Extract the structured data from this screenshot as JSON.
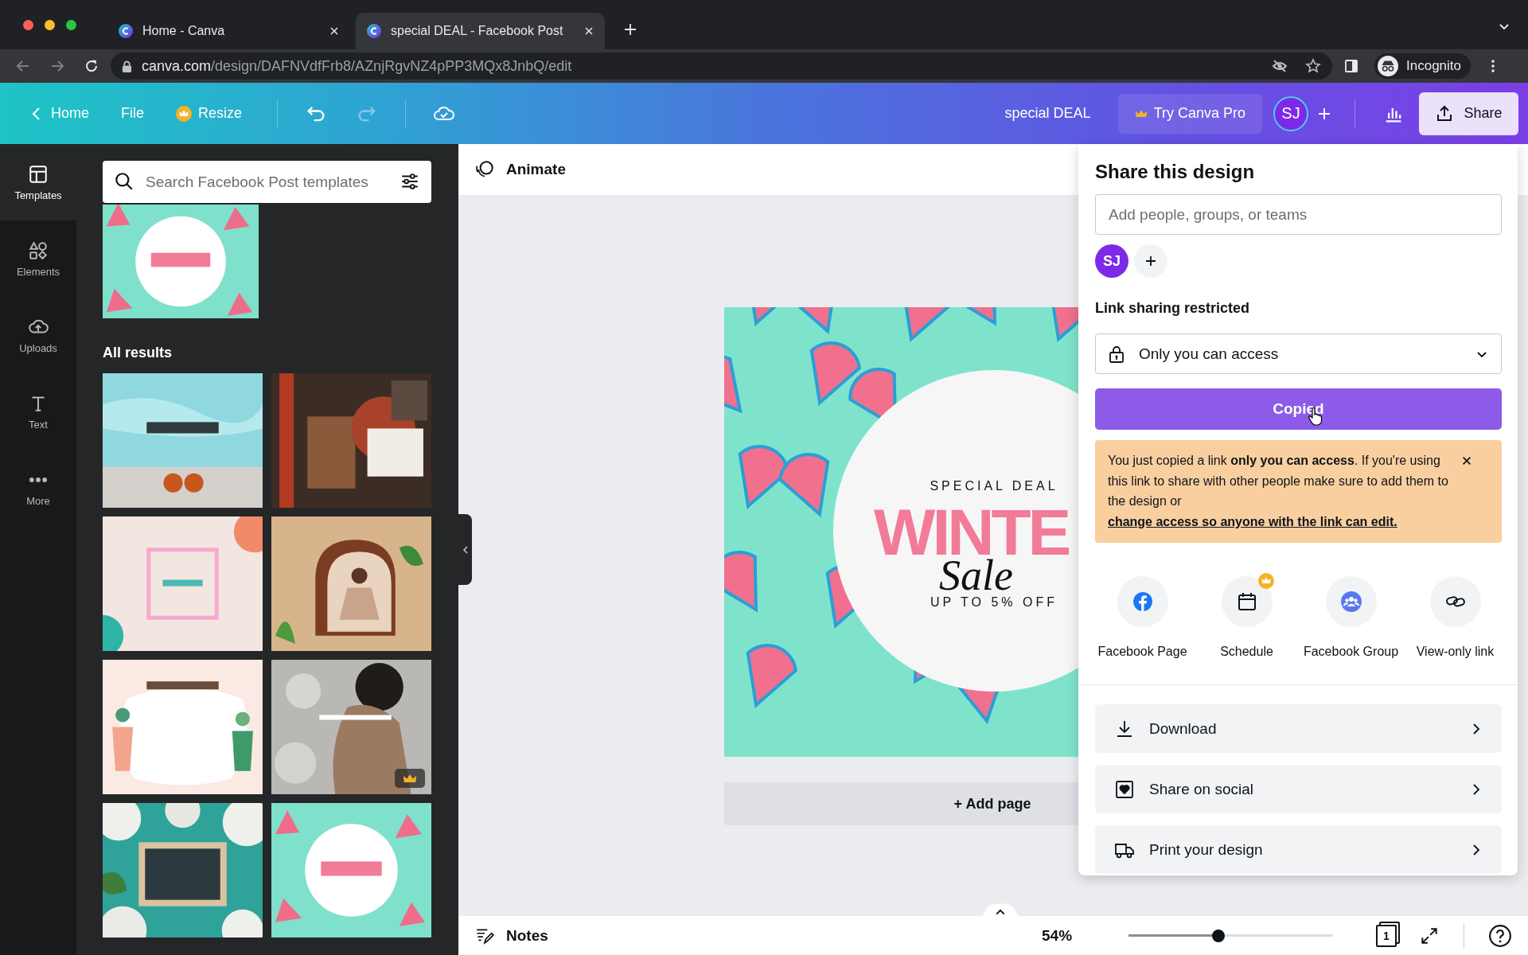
{
  "browser": {
    "tabs": [
      {
        "title": "Home - Canva",
        "selected": false
      },
      {
        "title": "special DEAL - Facebook Post",
        "selected": true
      }
    ],
    "url": "canva.com/design/DAFNVdfFrb8/AZnjRgvNZ4pPP3MQx8JnbQ/edit",
    "profile": "Incognito"
  },
  "toolbar": {
    "home": "Home",
    "file": "File",
    "resize": "Resize",
    "undo": {
      "disabled": false
    },
    "redo": {
      "disabled": true
    },
    "design_title": "special DEAL",
    "try_pro": "Try Canva Pro",
    "avatar": "SJ",
    "share": "Share"
  },
  "rail": [
    {
      "label": "Templates",
      "kind": "templates",
      "selected": true
    },
    {
      "label": "Elements",
      "kind": "elements",
      "selected": false
    },
    {
      "label": "Uploads",
      "kind": "uploads",
      "selected": false
    },
    {
      "label": "Text",
      "kind": "text",
      "selected": false
    },
    {
      "label": "More",
      "kind": "more",
      "selected": false
    }
  ],
  "templates_panel": {
    "search_placeholder": "Search Facebook Post templates",
    "recent": [
      {
        "kind": "picture",
        "premium": false
      }
    ],
    "heading": "All results",
    "results": [
      {
        "kind": "picture",
        "premium": false
      },
      {
        "kind": "picture",
        "premium": false
      },
      {
        "kind": "picture",
        "premium": false
      },
      {
        "kind": "picture",
        "premium": false
      },
      {
        "kind": "picture",
        "premium": false
      },
      {
        "kind": "picture",
        "premium": true
      },
      {
        "kind": "picture",
        "premium": false
      },
      {
        "kind": "picture",
        "premium": false
      }
    ]
  },
  "editor": {
    "animate": "Animate",
    "design": {
      "kicker": "SPECIAL DEAL",
      "headline": "WINTE",
      "script": "Sale",
      "offer": "UP TO 5% OFF"
    },
    "add_page": "+ Add page",
    "notes": "Notes",
    "zoom": "54%",
    "zoom_slider": {
      "level": 0.44
    },
    "page_count": "1"
  },
  "share_panel": {
    "title": "Share this design",
    "people_placeholder": "Add people, groups, or teams",
    "collaborators": [
      {
        "initials": "SJ"
      }
    ],
    "link_heading": "Link sharing restricted",
    "access": "Only you can access",
    "copy_button": "Copied",
    "notice": "You just copied a link **only you can access**. If you're using this link to share with other people make sure to add them to the design or",
    "notice_link": "change access so anyone with the link can edit.",
    "targets": [
      {
        "label": "Facebook Page",
        "kind": "facebook",
        "premium": false
      },
      {
        "label": "Schedule",
        "kind": "schedule",
        "premium": true
      },
      {
        "label": "Facebook Group",
        "kind": "group",
        "premium": false
      },
      {
        "label": "View-only link",
        "kind": "link",
        "premium": false
      }
    ],
    "actions": [
      {
        "label": "Download",
        "kind": "download"
      },
      {
        "label": "Share on social",
        "kind": "social"
      },
      {
        "label": "Print your design",
        "kind": "print"
      }
    ]
  }
}
